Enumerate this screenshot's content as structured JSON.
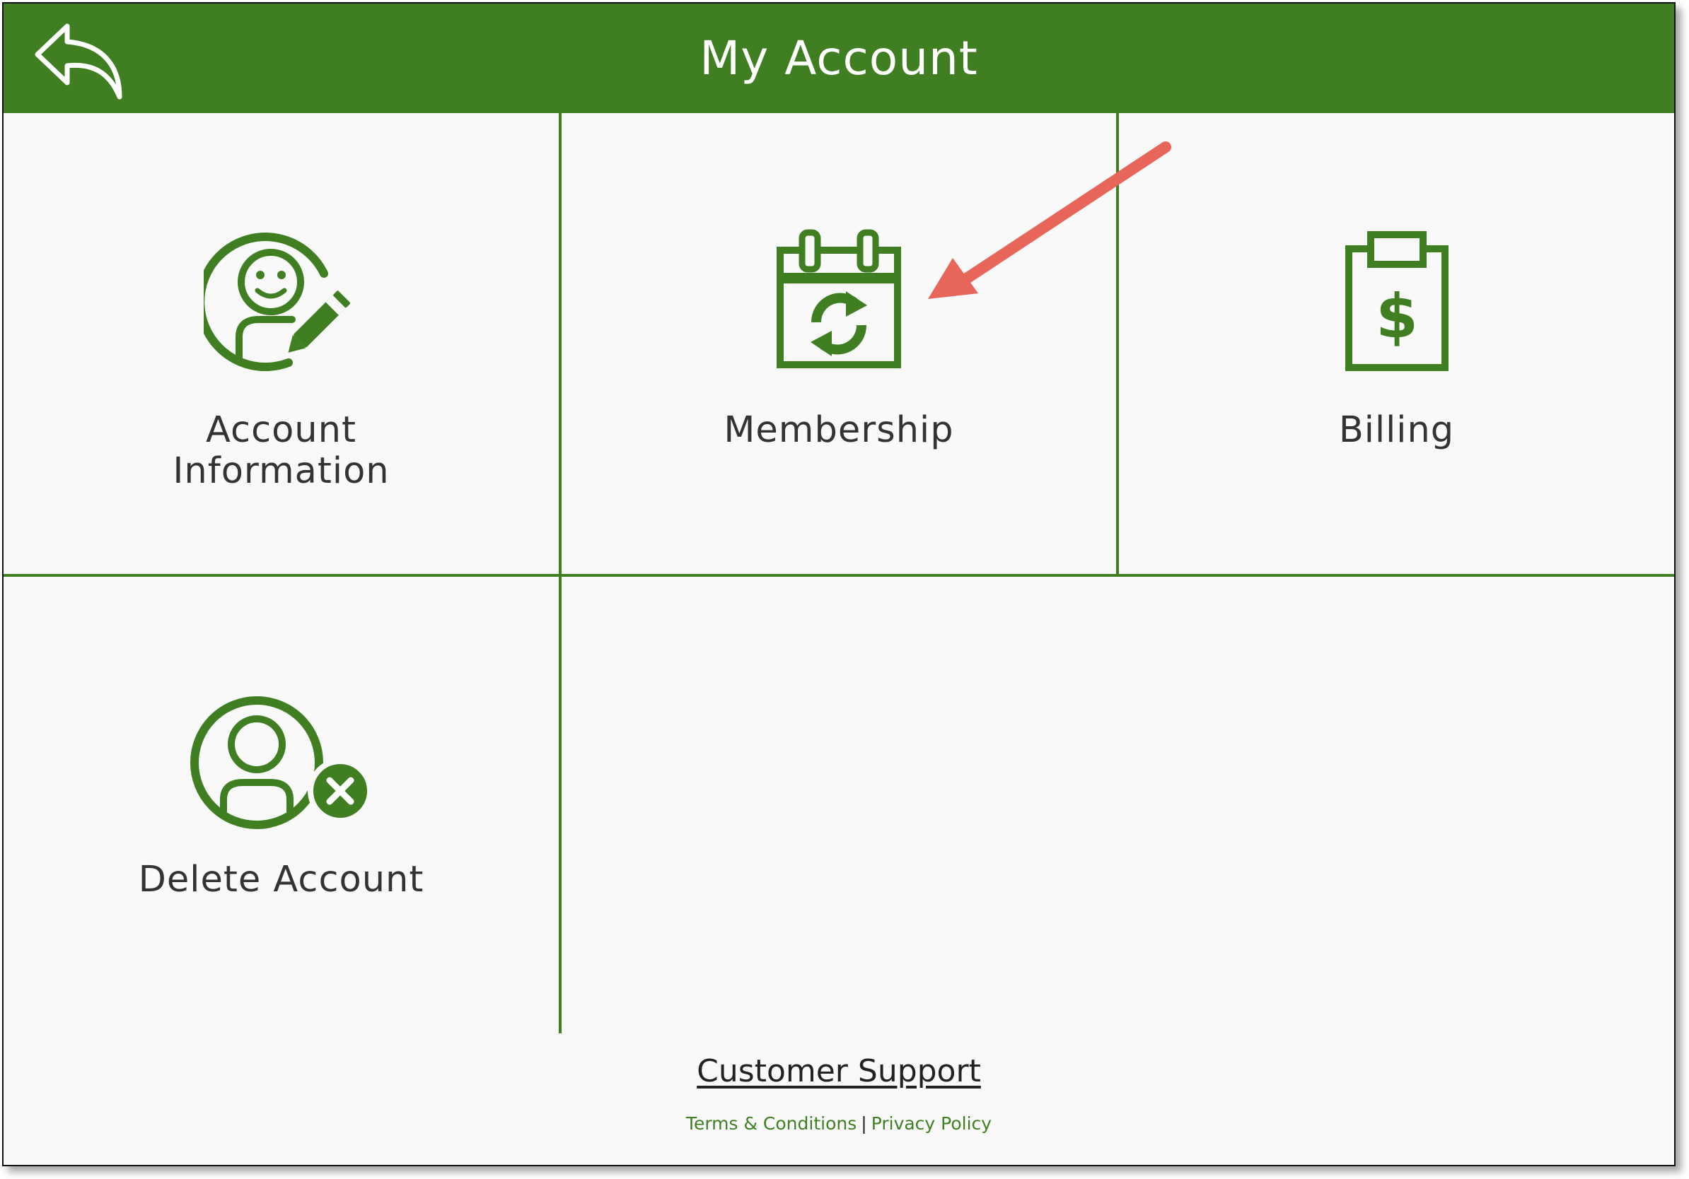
{
  "header": {
    "title": "My Account",
    "back_icon": "back-arrow-icon"
  },
  "tiles": [
    {
      "label_lines": [
        "Account",
        "Information"
      ],
      "icon": "account-edit-icon"
    },
    {
      "label_lines": [
        "Membership"
      ],
      "icon": "calendar-refresh-icon"
    },
    {
      "label_lines": [
        "Billing"
      ],
      "icon": "clipboard-dollar-icon"
    },
    {
      "label_lines": [
        "Delete Account"
      ],
      "icon": "user-remove-icon"
    }
  ],
  "footer": {
    "support_label": "Customer Support",
    "terms_label": "Terms & Conditions",
    "separator": "|",
    "privacy_label": "Privacy Policy"
  },
  "colors": {
    "brand_green": "#3f7f22",
    "background": "#f9f9f9",
    "annotation_arrow": "#e8655a"
  }
}
